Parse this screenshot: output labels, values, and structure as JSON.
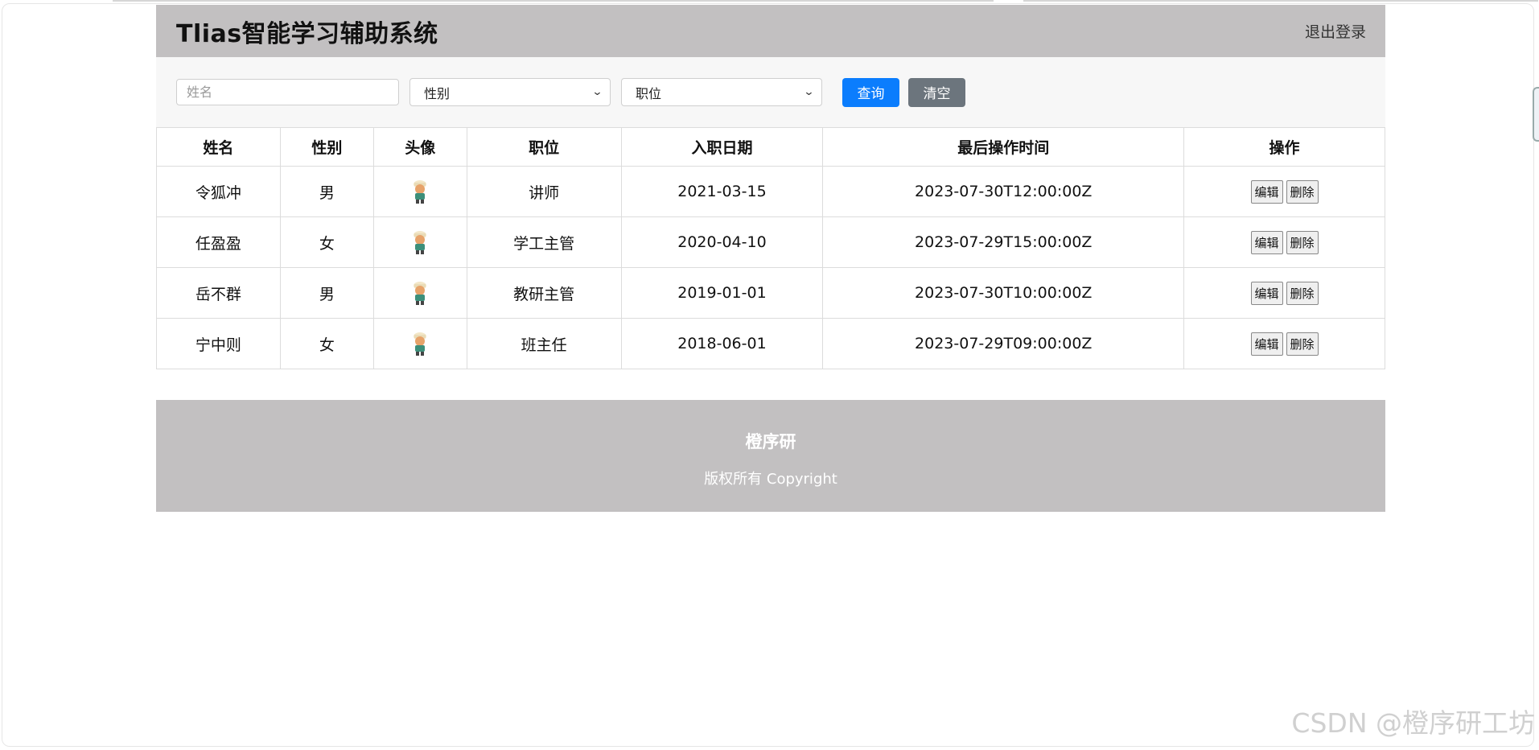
{
  "header": {
    "title": "Tlias智能学习辅助系统",
    "logout_label": "退出登录"
  },
  "search": {
    "name_placeholder": "姓名",
    "gender_selected": "性别",
    "position_selected": "职位",
    "query_label": "查询",
    "clear_label": "清空"
  },
  "table": {
    "headers": [
      "姓名",
      "性别",
      "头像",
      "职位",
      "入职日期",
      "最后操作时间",
      "操作"
    ],
    "rows": [
      {
        "name": "令狐冲",
        "gender": "男",
        "position": "讲师",
        "entry_date": "2021-03-15",
        "last_op": "2023-07-30T12:00:00Z"
      },
      {
        "name": "任盈盈",
        "gender": "女",
        "position": "学工主管",
        "entry_date": "2020-04-10",
        "last_op": "2023-07-29T15:00:00Z"
      },
      {
        "name": "岳不群",
        "gender": "男",
        "position": "教研主管",
        "entry_date": "2019-01-01",
        "last_op": "2023-07-30T10:00:00Z"
      },
      {
        "name": "宁中则",
        "gender": "女",
        "position": "班主任",
        "entry_date": "2018-06-01",
        "last_op": "2023-07-29T09:00:00Z"
      }
    ],
    "edit_label": "编辑",
    "delete_label": "删除"
  },
  "footer": {
    "title": "橙序研",
    "copyright": "版权所有 Copyright"
  },
  "watermark": "CSDN @橙序研工坊",
  "colors": {
    "header_bg": "#c2c0c1",
    "query_btn": "#0b7dfd",
    "clear_btn": "#6c757d"
  }
}
